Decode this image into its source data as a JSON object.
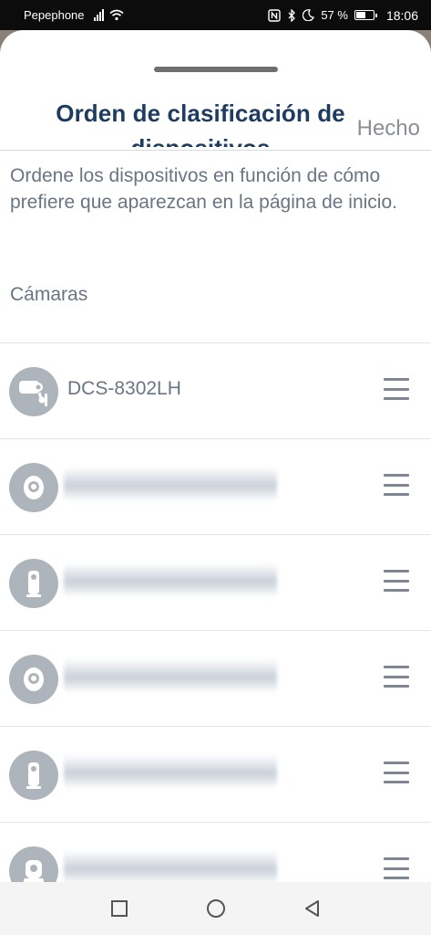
{
  "status_bar": {
    "carrier": "Pepephone",
    "battery_text": "57 %",
    "battery_level": 0.57,
    "time": "18:06",
    "icons": [
      "signal-icon",
      "wifi-icon",
      "nfc-icon",
      "bluetooth-icon",
      "moon-icon",
      "battery-icon"
    ]
  },
  "sheet": {
    "title": "Orden de clasificación de dispositivos",
    "done_label": "Hecho",
    "description": "Ordene los dispositivos en función de cómo prefiere que aparezcan en la página de inicio.",
    "section_label": "Cámaras",
    "devices": [
      {
        "name": "DCS-8302LH",
        "icon": "outdoor-camera-icon",
        "name_visible": true
      },
      {
        "name": "",
        "icon": "dome-camera-icon",
        "name_visible": false
      },
      {
        "name": "",
        "icon": "slim-camera-icon",
        "name_visible": false
      },
      {
        "name": "",
        "icon": "dome-camera-icon",
        "name_visible": false
      },
      {
        "name": "",
        "icon": "slim-camera-icon",
        "name_visible": false
      },
      {
        "name": "",
        "icon": "pan-tilt-camera-icon",
        "name_visible": false
      }
    ]
  },
  "nav_bar": {
    "buttons": [
      "recents-square-icon",
      "home-circle-icon",
      "back-triangle-icon"
    ]
  },
  "colors": {
    "title": "#1d3c5f",
    "text": "#6a7583",
    "avatar": "#aeb4bb"
  }
}
